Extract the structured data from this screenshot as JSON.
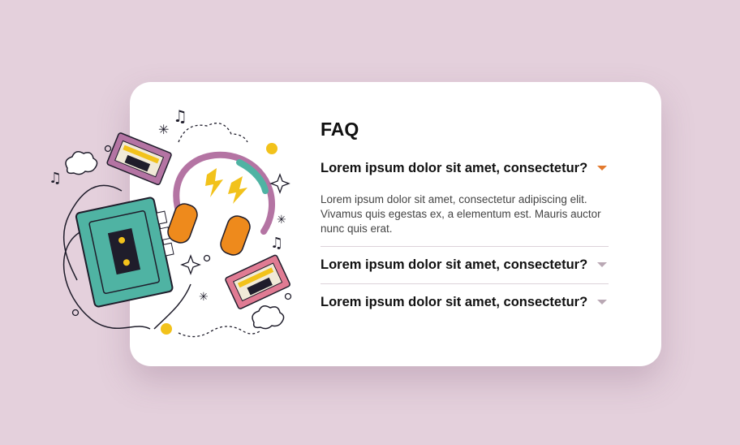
{
  "faq": {
    "title": "FAQ",
    "items": [
      {
        "question": "Lorem ipsum dolor sit amet, consectetur?",
        "answer": "Lorem ipsum dolor sit amet, consectetur adipiscing elit. Vivamus quis egestas ex, a elementum est. Mauris auctor nunc quis erat.",
        "expanded": true,
        "icon": "chevron-down-icon"
      },
      {
        "question": "Lorem ipsum dolor sit amet, consectetur?",
        "expanded": false,
        "icon": "chevron-down-icon"
      },
      {
        "question": "Lorem ipsum dolor sit amet, consectetur?",
        "expanded": false,
        "icon": "chevron-down-icon"
      }
    ]
  },
  "colors": {
    "background": "#e4d0dc",
    "card": "#ffffff",
    "accent": "#e37a2e",
    "caret_inactive": "#b9a8b4"
  },
  "illustration": {
    "icon": "music-cassette-illustration"
  }
}
